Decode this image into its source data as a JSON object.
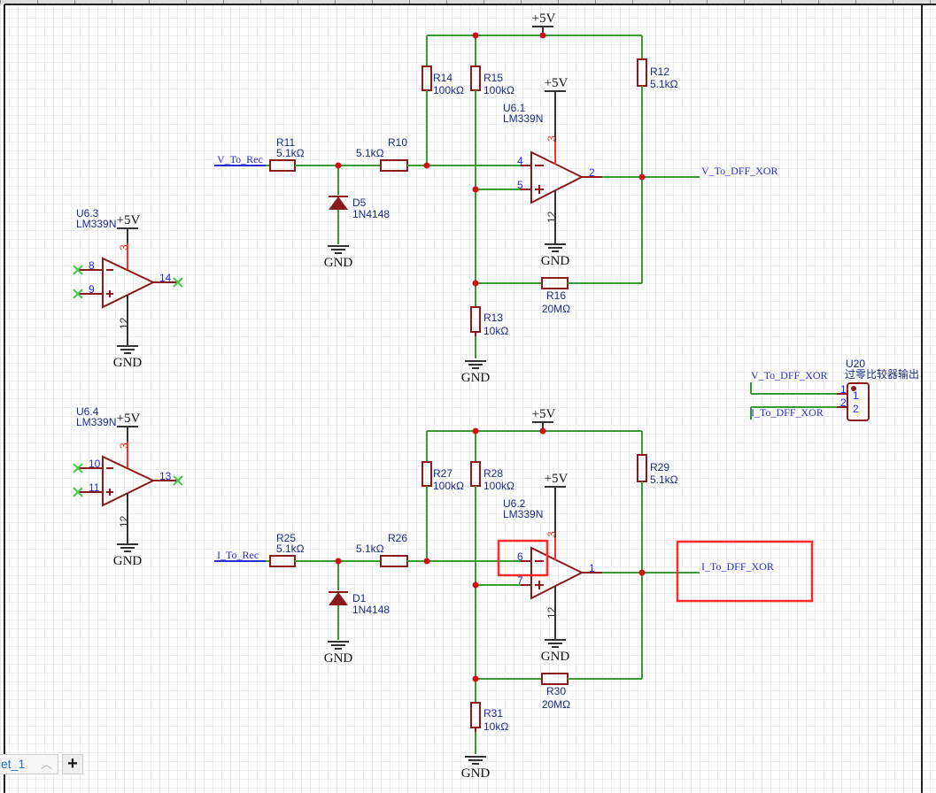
{
  "colors": {
    "wire": "#3a9a34",
    "component": "#8b1a1a",
    "junction": "#d01010",
    "highlight": "#ff2a2a",
    "net_label": "#2b2bd8"
  },
  "power": {
    "vcc": "+5V",
    "gnd": "GND"
  },
  "circuits": [
    {
      "input_net": "V_To_Rec",
      "output_net": "V_To_DFF_XOR",
      "unit": "U6.1",
      "part": "LM339N",
      "pin_minus": "4",
      "pin_plus": "5",
      "pin_out": "2",
      "pin_vcc": "3",
      "pin_gnd": "12",
      "r_in1": {
        "ref": "R11",
        "value": "5.1kΩ"
      },
      "r_in2": {
        "ref": "R10",
        "value": "5.1kΩ"
      },
      "r_pull1": {
        "ref": "R14",
        "value": "100kΩ"
      },
      "r_pull2": {
        "ref": "R15",
        "value": "100kΩ"
      },
      "r_out": {
        "ref": "R12",
        "value": "5.1kΩ"
      },
      "r_fb": {
        "ref": "R16",
        "value": "20MΩ"
      },
      "r_gnd": {
        "ref": "R13",
        "value": "10kΩ"
      },
      "diode": {
        "ref": "D5",
        "value": "1N4148"
      }
    },
    {
      "input_net": "I_To_Rec",
      "output_net": "I_To_DFF_XOR",
      "unit": "U6.2",
      "part": "LM339N",
      "pin_minus": "6",
      "pin_plus": "7",
      "pin_out": "1",
      "pin_vcc": "3",
      "pin_gnd": "12",
      "r_in1": {
        "ref": "R25",
        "value": "5.1kΩ"
      },
      "r_in2": {
        "ref": "R26",
        "value": "5.1kΩ"
      },
      "r_pull1": {
        "ref": "R27",
        "value": "100kΩ"
      },
      "r_pull2": {
        "ref": "R28",
        "value": "100kΩ"
      },
      "r_out": {
        "ref": "R29",
        "value": "5.1kΩ"
      },
      "r_fb": {
        "ref": "R30",
        "value": "20MΩ"
      },
      "r_gnd": {
        "ref": "R31",
        "value": "10kΩ"
      },
      "diode": {
        "ref": "D1",
        "value": "1N4148"
      }
    }
  ],
  "unused_units": [
    {
      "unit": "U6.3",
      "part": "LM339N",
      "pin_minus": "8",
      "pin_plus": "9",
      "pin_out": "14",
      "pin_vcc": "3",
      "pin_gnd": "12"
    },
    {
      "unit": "U6.4",
      "part": "LM339N",
      "pin_minus": "10",
      "pin_plus": "11",
      "pin_out": "13",
      "pin_vcc": "3",
      "pin_gnd": "12"
    }
  ],
  "connector": {
    "ref": "U20",
    "name": "过零比较器输出",
    "net1": "V_To_DFF_XOR",
    "net2": "I_To_DFF_XOR",
    "pin1": "1",
    "pin2": "2"
  },
  "sheet_tab": {
    "label": "et_1",
    "add_label": "+"
  }
}
